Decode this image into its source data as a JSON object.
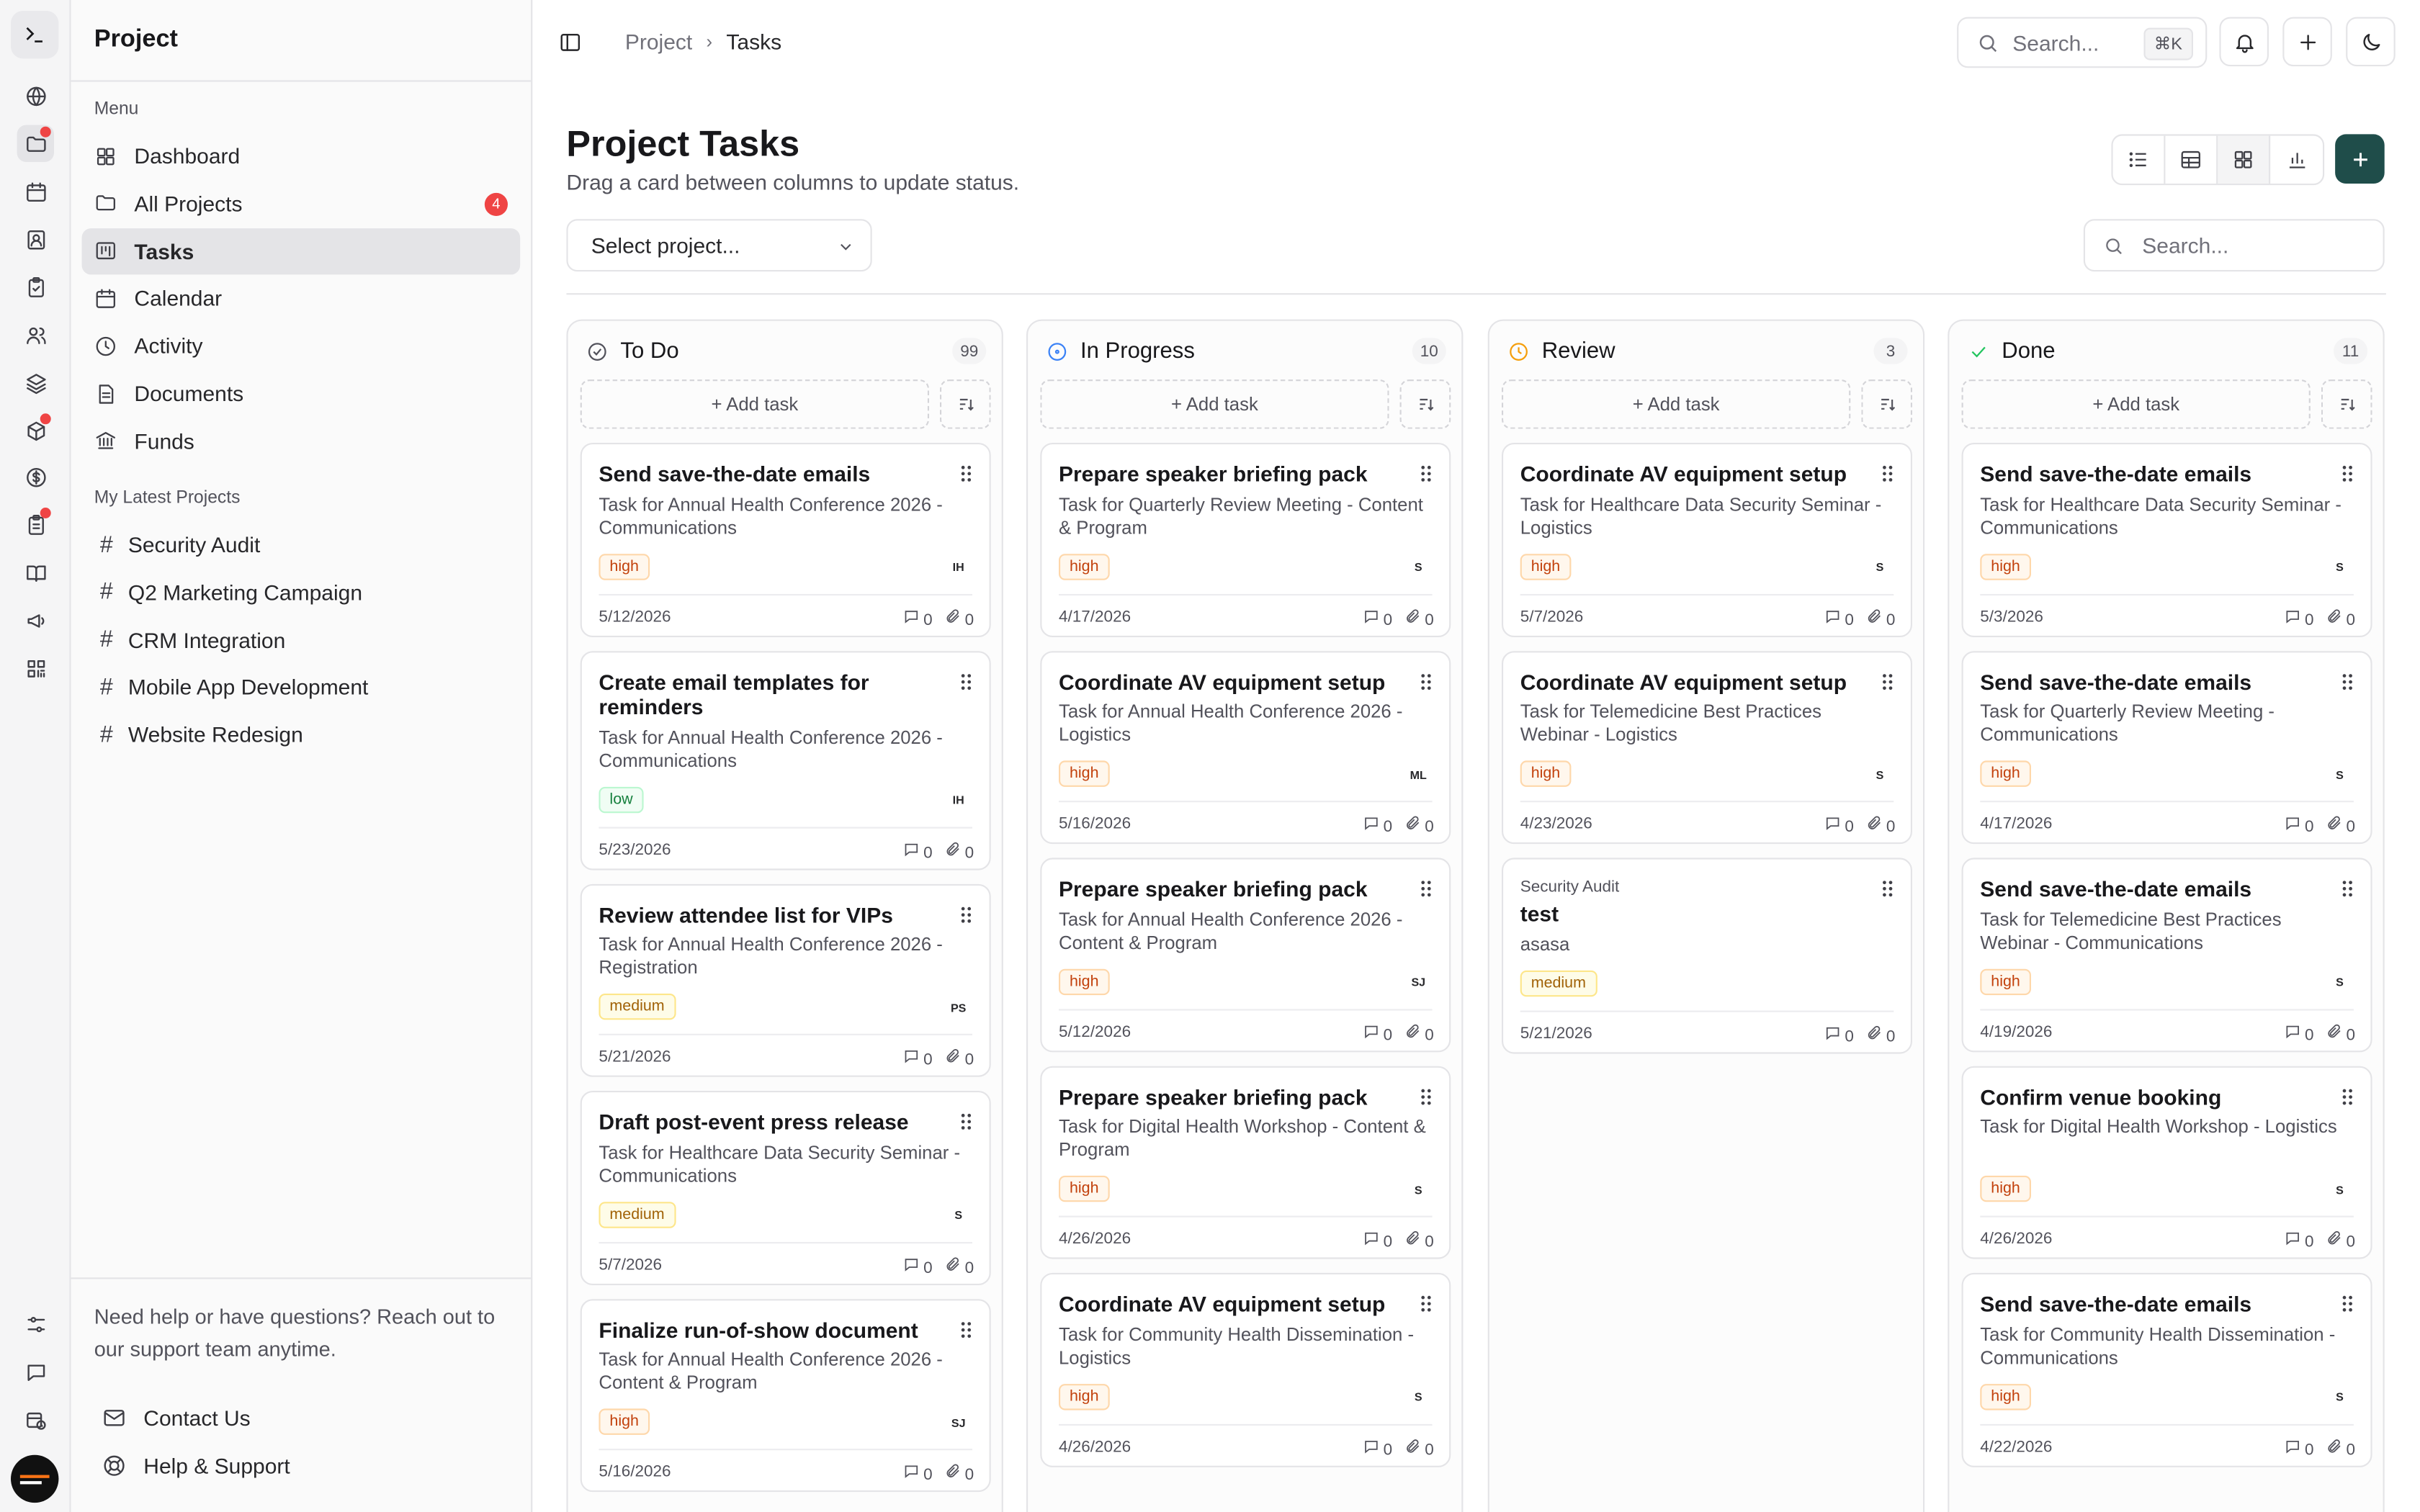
{
  "sidebar": {
    "title": "Project",
    "menu_heading": "Menu",
    "menu": [
      {
        "label": "Dashboard",
        "icon": "dashboard-icon"
      },
      {
        "label": "All Projects",
        "icon": "folder-icon",
        "badge": "4"
      },
      {
        "label": "Tasks",
        "icon": "kanban-icon",
        "active": true
      },
      {
        "label": "Calendar",
        "icon": "calendar-icon"
      },
      {
        "label": "Activity",
        "icon": "clock-icon"
      },
      {
        "label": "Documents",
        "icon": "document-icon"
      },
      {
        "label": "Funds",
        "icon": "bank-icon"
      }
    ],
    "projects_heading": "My Latest Projects",
    "projects": [
      "Security Audit",
      "Q2 Marketing Campaign",
      "CRM Integration",
      "Mobile App Development",
      "Website Redesign"
    ],
    "help_text": "Need help or have questions? Reach out to our support team anytime.",
    "contact_label": "Contact Us",
    "support_label": "Help & Support"
  },
  "rail": {
    "icons": [
      "terminal-icon",
      "globe-icon",
      "folder-icon",
      "calendar-icon",
      "contacts-icon",
      "clipboard-check-icon",
      "users-icon",
      "layers-icon",
      "package-icon",
      "dollar-icon",
      "clipboard-list-icon",
      "book-icon",
      "megaphone-icon",
      "qr-code-icon",
      "settings-sliders-icon",
      "message-icon",
      "calendar-clock-icon"
    ]
  },
  "topbar": {
    "breadcrumb_root": "Project",
    "breadcrumb_sep": "›",
    "breadcrumb_current": "Tasks",
    "search_placeholder": "Search...",
    "search_shortcut": "⌘K"
  },
  "page": {
    "title": "Project Tasks",
    "subtitle": "Drag a card between columns to update status.",
    "select_project": "Select project...",
    "search_placeholder": "Search...",
    "add_task_label": "+ Add task"
  },
  "columns": [
    {
      "name": "To Do",
      "count": "99",
      "icon": "circle-check-icon",
      "color": "#52525b",
      "cards": [
        {
          "title": "Send save-the-date emails",
          "desc": "Task for Annual Health Conference 2026 - Communications",
          "priority": "high",
          "initials": "IH",
          "date": "5/12/2026",
          "comments": "0",
          "attachments": "0"
        },
        {
          "title": "Create email templates for reminders",
          "desc": "Task for Annual Health Conference 2026 - Communications",
          "priority": "low",
          "initials": "IH",
          "date": "5/23/2026",
          "comments": "0",
          "attachments": "0"
        },
        {
          "title": "Review attendee list for VIPs",
          "desc": "Task for Annual Health Conference 2026 - Registration",
          "priority": "medium",
          "initials": "PS",
          "date": "5/21/2026",
          "comments": "0",
          "attachments": "0"
        },
        {
          "title": "Draft post-event press release",
          "desc": "Task for Healthcare Data Security Seminar - Communications",
          "priority": "medium",
          "initials": "S",
          "date": "5/7/2026",
          "comments": "0",
          "attachments": "0"
        },
        {
          "title": "Finalize run-of-show document",
          "desc": "Task for Annual Health Conference 2026 - Content & Program",
          "priority": "high",
          "initials": "SJ",
          "date": "5/16/2026",
          "comments": "0",
          "attachments": "0"
        }
      ]
    },
    {
      "name": "In Progress",
      "count": "10",
      "icon": "circle-dashed-icon",
      "color": "#3b82f6",
      "cards": [
        {
          "title": "Prepare speaker briefing pack",
          "desc": "Task for Quarterly Review Meeting - Content & Program",
          "priority": "high",
          "initials": "S",
          "date": "4/17/2026",
          "comments": "0",
          "attachments": "0"
        },
        {
          "title": "Coordinate AV equipment setup",
          "desc": "Task for Annual Health Conference 2026 - Logistics",
          "priority": "high",
          "initials": "ML",
          "date": "5/16/2026",
          "comments": "0",
          "attachments": "0"
        },
        {
          "title": "Prepare speaker briefing pack",
          "desc": "Task for Annual Health Conference 2026 - Content & Program",
          "priority": "high",
          "initials": "SJ",
          "date": "5/12/2026",
          "comments": "0",
          "attachments": "0"
        },
        {
          "title": "Prepare speaker briefing pack",
          "desc": "Task for Digital Health Workshop - Content & Program",
          "priority": "high",
          "initials": "S",
          "date": "4/26/2026",
          "comments": "0",
          "attachments": "0"
        },
        {
          "title": "Coordinate AV equipment setup",
          "desc": "Task for Community Health Dissemination - Logistics",
          "priority": "high",
          "initials": "S",
          "date": "4/26/2026",
          "comments": "0",
          "attachments": "0"
        }
      ]
    },
    {
      "name": "Review",
      "count": "3",
      "icon": "clock-icon",
      "color": "#f59e0b",
      "cards": [
        {
          "title": "Coordinate AV equipment setup",
          "desc": "Task for Healthcare Data Security Seminar - Logistics",
          "priority": "high",
          "initials": "S",
          "date": "5/7/2026",
          "comments": "0",
          "attachments": "0"
        },
        {
          "title": "Coordinate AV equipment setup",
          "desc": "Task for Telemedicine Best Practices Webinar - Logistics",
          "priority": "high",
          "initials": "S",
          "date": "4/23/2026",
          "comments": "0",
          "attachments": "0"
        },
        {
          "project": "Security Audit",
          "title": "test",
          "desc": "asasa",
          "priority": "medium",
          "initials": "",
          "date": "5/21/2026",
          "comments": "0",
          "attachments": "0"
        }
      ]
    },
    {
      "name": "Done",
      "count": "11",
      "icon": "check-icon",
      "color": "#22c55e",
      "cards": [
        {
          "title": "Send save-the-date emails",
          "desc": "Task for Healthcare Data Security Seminar - Communications",
          "priority": "high",
          "initials": "S",
          "date": "5/3/2026",
          "comments": "0",
          "attachments": "0"
        },
        {
          "title": "Send save-the-date emails",
          "desc": "Task for Quarterly Review Meeting - Communications",
          "priority": "high",
          "initials": "S",
          "date": "4/17/2026",
          "comments": "0",
          "attachments": "0"
        },
        {
          "title": "Send save-the-date emails",
          "desc": "Task for Telemedicine Best Practices Webinar - Communications",
          "priority": "high",
          "initials": "S",
          "date": "4/19/2026",
          "comments": "0",
          "attachments": "0"
        },
        {
          "title": "Confirm venue booking",
          "desc": "Task for Digital Health Workshop - Logistics",
          "priority": "high",
          "initials": "S",
          "date": "4/26/2026",
          "comments": "0",
          "attachments": "0"
        },
        {
          "title": "Send save-the-date emails",
          "desc": "Task for Community Health Dissemination - Communications",
          "priority": "high",
          "initials": "S",
          "date": "4/22/2026",
          "comments": "0",
          "attachments": "0"
        }
      ]
    }
  ],
  "colors": {
    "accent": "#1f4d4a",
    "badge": "#ef4444"
  }
}
